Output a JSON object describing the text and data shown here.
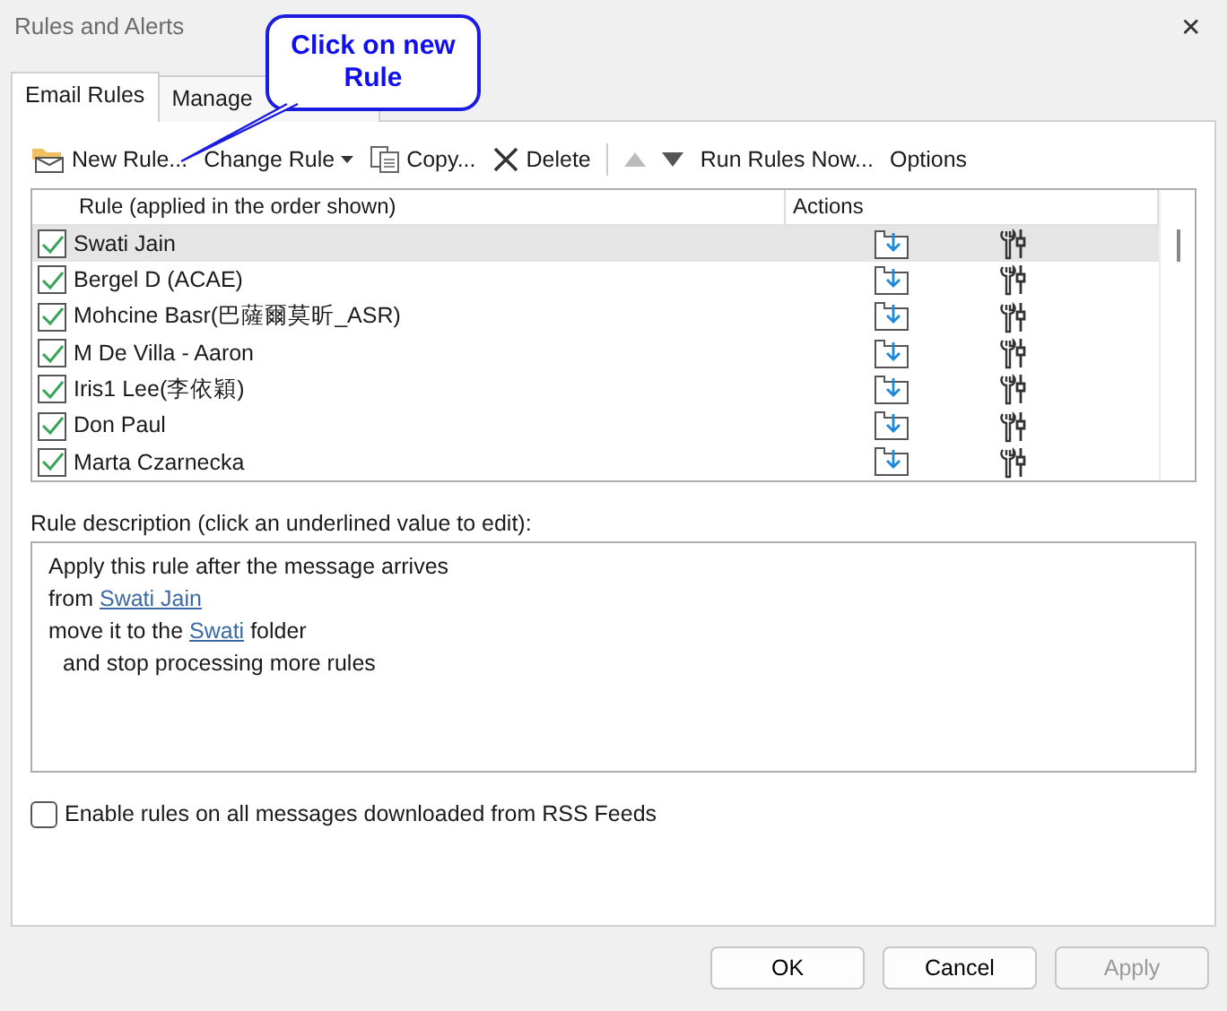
{
  "window": {
    "title": "Rules and Alerts",
    "close": "✕"
  },
  "callout": {
    "text": "Click on new Rule"
  },
  "tabs": [
    {
      "label": "Email Rules",
      "selected": true
    },
    {
      "label": "Manage",
      "selected": false
    }
  ],
  "toolbar": [
    {
      "kind": "new",
      "label": "New Rule...",
      "disabled": false
    },
    {
      "kind": "change",
      "label": "Change Rule",
      "disabled": false
    },
    {
      "kind": "copy",
      "label": "Copy...",
      "disabled": false
    },
    {
      "kind": "delete",
      "label": "Delete",
      "disabled": false
    },
    {
      "kind": "sep"
    },
    {
      "kind": "up",
      "disabled": true
    },
    {
      "kind": "down",
      "disabled": false
    },
    {
      "kind": "text",
      "label": "Run Rules Now...",
      "disabled": false
    },
    {
      "kind": "text",
      "label": "Options",
      "disabled": false
    }
  ],
  "rules_table": {
    "columns": [
      "Rule (applied in the order shown)",
      "Actions"
    ],
    "rows": [
      {
        "name": "Swati Jain",
        "checked": true,
        "selected": true
      },
      {
        "name": "Bergel D (ACAE)",
        "checked": true,
        "selected": false
      },
      {
        "name": "Mohcine Basr(巴薩爾莫昕_ASR)",
        "checked": true,
        "selected": false
      },
      {
        "name": "M De Villa - Aaron",
        "checked": true,
        "selected": false
      },
      {
        "name": "Iris1 Lee(李依穎)",
        "checked": true,
        "selected": false
      },
      {
        "name": "Don Paul",
        "checked": true,
        "selected": false
      },
      {
        "name": "Marta Czarnecka",
        "checked": true,
        "selected": false
      }
    ]
  },
  "description": {
    "label": "Rule description (click an underlined value to edit):",
    "lines": [
      {
        "indented": false,
        "parts": [
          {
            "text": "Apply this rule after the message arrives",
            "link": false
          }
        ]
      },
      {
        "indented": false,
        "parts": [
          {
            "text": "from ",
            "link": false
          },
          {
            "text": "Swati Jain",
            "link": true
          }
        ]
      },
      {
        "indented": false,
        "parts": [
          {
            "text": "move it to the ",
            "link": false
          },
          {
            "text": "Swati",
            "link": true
          },
          {
            "text": " folder",
            "link": false
          }
        ]
      },
      {
        "indented": true,
        "parts": [
          {
            "text": "and stop processing more rules",
            "link": false
          }
        ]
      }
    ]
  },
  "rss_option": {
    "label": "Enable rules on all messages downloaded from RSS Feeds",
    "checked": false
  },
  "buttons": [
    {
      "label": "OK",
      "disabled": false
    },
    {
      "label": "Cancel",
      "disabled": false
    },
    {
      "label": "Apply",
      "disabled": true
    }
  ]
}
